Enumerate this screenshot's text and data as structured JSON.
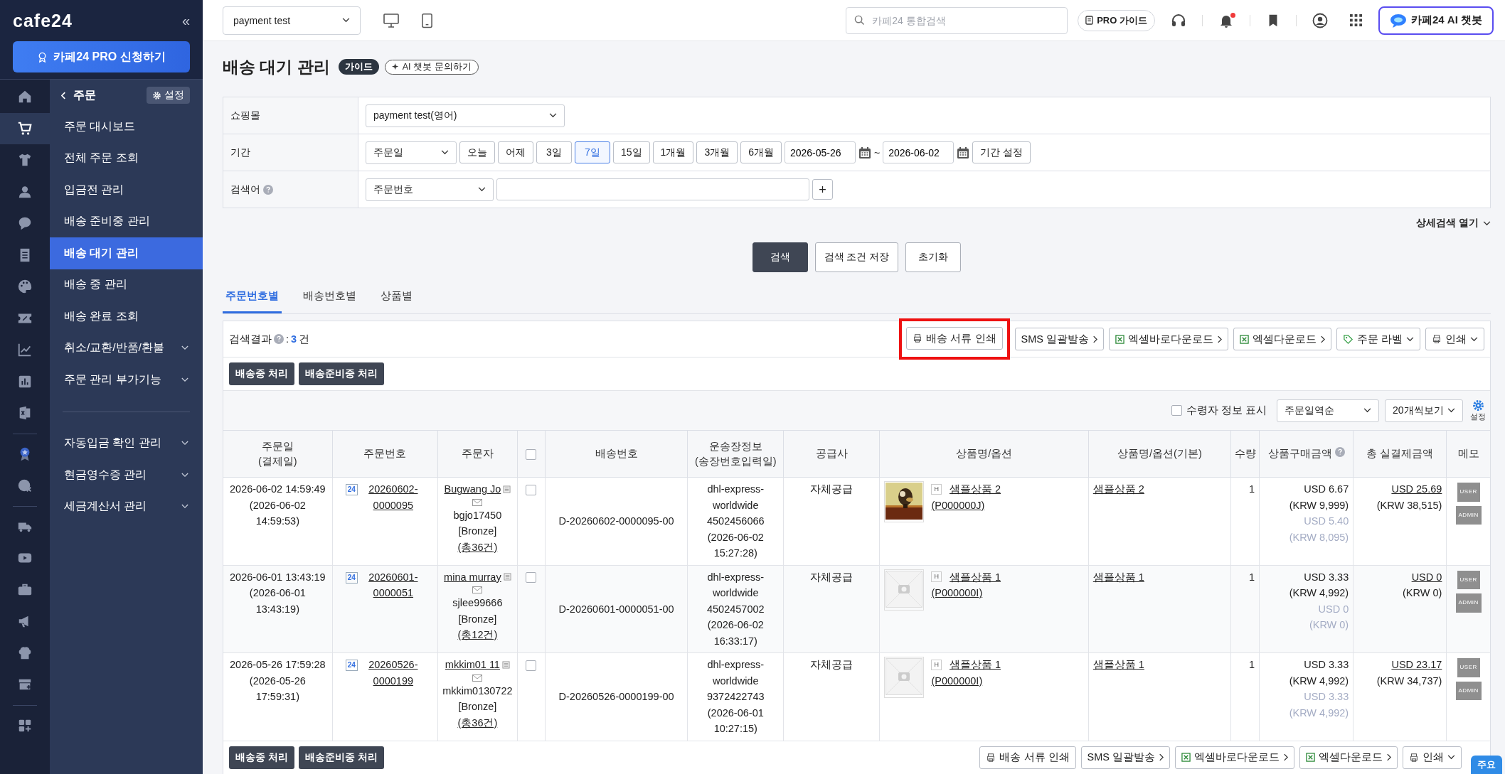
{
  "sidebar": {
    "logo": "cafe24",
    "collapse": "«",
    "pro_button": "카페24 PRO 신청하기",
    "rail": [
      {
        "kind": "nav",
        "selected": false
      },
      {
        "kind": "nav",
        "selected": true
      },
      {
        "kind": "nav",
        "selected": false
      },
      {
        "kind": "nav",
        "selected": false
      },
      {
        "kind": "nav",
        "selected": false
      },
      {
        "kind": "nav",
        "selected": false
      },
      {
        "kind": "nav",
        "selected": false
      },
      {
        "kind": "nav",
        "selected": false
      },
      {
        "kind": "nav",
        "selected": false
      },
      {
        "kind": "nav",
        "selected": false
      },
      {
        "kind": "nav",
        "selected": false
      },
      {
        "kind": "separator"
      },
      {
        "kind": "nav",
        "selected": false
      },
      {
        "kind": "nav",
        "selected": false
      },
      {
        "kind": "separator"
      },
      {
        "kind": "nav",
        "selected": false
      },
      {
        "kind": "nav",
        "selected": false
      },
      {
        "kind": "nav",
        "selected": false
      },
      {
        "kind": "nav",
        "selected": false
      },
      {
        "kind": "nav",
        "selected": false
      },
      {
        "kind": "nav",
        "selected": false
      },
      {
        "kind": "separator"
      },
      {
        "kind": "nav",
        "selected": false
      }
    ],
    "section": "주문",
    "settings_button": "설정",
    "menu_groups": [
      {
        "items": [
          {
            "label": "주문 대시보드",
            "selected": false,
            "expandable": false
          },
          {
            "label": "전체 주문 조회",
            "selected": false,
            "expandable": false
          },
          {
            "label": "입금전 관리",
            "selected": false,
            "expandable": false
          },
          {
            "label": "배송 준비중 관리",
            "selected": false,
            "expandable": false
          },
          {
            "label": "배송 대기 관리",
            "selected": true,
            "expandable": false
          },
          {
            "label": "배송 중 관리",
            "selected": false,
            "expandable": false
          },
          {
            "label": "배송 완료 조회",
            "selected": false,
            "expandable": false
          },
          {
            "label": "취소/교환/반품/환불",
            "selected": false,
            "expandable": true
          },
          {
            "label": "주문 관리 부가기능",
            "selected": false,
            "expandable": true
          }
        ]
      },
      {
        "items": [
          {
            "label": "자동입금 확인 관리",
            "selected": false,
            "expandable": true
          },
          {
            "label": "현금영수증 관리",
            "selected": false,
            "expandable": true
          },
          {
            "label": "세금계산서 관리",
            "selected": false,
            "expandable": true
          }
        ]
      }
    ]
  },
  "topbar": {
    "shop_select": "payment test",
    "search_placeholder": "카페24 통합검색",
    "pro_guide": "PRO 가이드",
    "has_new_notification": true,
    "ai_button": "카페24 AI 챗봇"
  },
  "page": {
    "title": "배송 대기 관리",
    "guide_badge": "가이드",
    "ai_chip": "AI 챗봇 문의하기"
  },
  "filters": {
    "shop_label": "쇼핑몰",
    "shop_value": "payment test(영어)",
    "period_label": "기간",
    "date_type": "주문일",
    "periods": [
      {
        "label": "오늘",
        "selected": false
      },
      {
        "label": "어제",
        "selected": false
      },
      {
        "label": "3일",
        "selected": false
      },
      {
        "label": "7일",
        "selected": true
      },
      {
        "label": "15일",
        "selected": false
      },
      {
        "label": "1개월",
        "selected": false
      },
      {
        "label": "3개월",
        "selected": false
      },
      {
        "label": "6개월",
        "selected": false
      }
    ],
    "start_date": "2026-05-26",
    "range_sep": "~",
    "end_date": "2026-06-02",
    "period_settings": "기간 설정",
    "keyword_label": "검색어",
    "keyword_type": "주문번호",
    "add_button": "+",
    "detail_toggle": "상세검색 열기"
  },
  "search_actions": [
    "검색",
    "검색 조건 저장",
    "초기화"
  ],
  "tabs": [
    {
      "label": "주문번호별",
      "selected": true
    },
    {
      "label": "배송번호별",
      "selected": false
    },
    {
      "label": "상품별",
      "selected": false
    }
  ],
  "results": {
    "label": "검색결과",
    "separator": ":",
    "count": "3",
    "unit": "건",
    "toolbar": [
      {
        "label": "배송 서류 인쇄",
        "kind": "print",
        "highlighted": true
      },
      {
        "label": "SMS 일괄발송",
        "kind": "link",
        "highlighted": false
      },
      {
        "label": "엑셀바로다운로드",
        "kind": "excel",
        "highlighted": false
      },
      {
        "label": "엑셀다운로드",
        "kind": "excel",
        "highlighted": false
      },
      {
        "label": "주문 라벨",
        "kind": "tag-menu",
        "highlighted": false
      },
      {
        "label": "인쇄",
        "kind": "print-menu",
        "highlighted": false
      }
    ],
    "bulk_buttons": [
      "배송중 처리",
      "배송준비중 처리"
    ],
    "show_receiver": {
      "label": "수령자 정보 표시",
      "checked": false
    },
    "sort": "주문일역순",
    "page_size": "20개씩보기",
    "settings": "설정"
  },
  "table": {
    "columns": [
      {
        "kind": "text",
        "label": "주문일",
        "sublabel": "(결제일)"
      },
      {
        "kind": "text",
        "label": "주문번호"
      },
      {
        "kind": "text",
        "label": "주문자"
      },
      {
        "kind": "checkbox",
        "checked": false
      },
      {
        "kind": "text",
        "label": "배송번호"
      },
      {
        "kind": "text",
        "label": "운송장정보",
        "sublabel": "(송장번호입력일)"
      },
      {
        "kind": "text",
        "label": "공급사"
      },
      {
        "kind": "text",
        "label": "상품명/옵션"
      },
      {
        "kind": "text",
        "label": "상품명/옵션(기본)"
      },
      {
        "kind": "text",
        "label": "수량"
      },
      {
        "kind": "help",
        "label": "상품구매금액"
      },
      {
        "kind": "text",
        "label": "총 실결제금액"
      },
      {
        "kind": "text",
        "label": "메모"
      }
    ],
    "rows": [
      {
        "order_date": "2026-06-02 14:59:49",
        "paid_date": "(2026-06-02 14:59:53)",
        "order_badge": "24",
        "order_no": "20260602-0000095",
        "customer": "Bugwang Jo",
        "member_id": "bgjo17450",
        "grade": "[Bronze]",
        "total_orders": "(총36건)",
        "checked": false,
        "shipping_no": "D-20260602-0000095-00",
        "carrier": "dhl-express-worldwide",
        "tracking": "4502456066",
        "tracking_date": "(2026-06-02 15:27:28)",
        "supplier": "자체공급",
        "thumbnail": {
          "kind": "picture"
        },
        "product_badge": "H",
        "product": "샘플상품 2",
        "product_code": "(P000000J)",
        "base_product": "샘플상품 2",
        "qty": "1",
        "price": "USD 6.67",
        "price_krw": "(KRW 9,999)",
        "discount": "USD 5.40",
        "discount_krw": "(KRW 8,095)",
        "total": "USD 25.69",
        "total_krw": "(KRW 38,515)",
        "memo": [
          "USER",
          "ADMIN"
        ]
      },
      {
        "order_date": "2026-06-01 13:43:19",
        "paid_date": "(2026-06-01 13:43:19)",
        "order_badge": "24",
        "order_no": "20260601-0000051",
        "customer": "mina murray",
        "member_id": "sjlee99666",
        "grade": "[Bronze]",
        "total_orders": "(총12건)",
        "checked": false,
        "shipping_no": "D-20260601-0000051-00",
        "carrier": "dhl-express-worldwide",
        "tracking": "4502457002",
        "tracking_date": "(2026-06-02 16:33:17)",
        "supplier": "자체공급",
        "thumbnail": {
          "kind": "placeholder"
        },
        "product_badge": "H",
        "product": "샘플상품 1",
        "product_code": "(P000000I)",
        "base_product": "샘플상품 1",
        "qty": "1",
        "price": "USD 3.33",
        "price_krw": "(KRW 4,992)",
        "discount": "USD 0",
        "discount_krw": "(KRW 0)",
        "total": "USD 0",
        "total_krw": "(KRW 0)",
        "memo": [
          "USER",
          "ADMIN"
        ]
      },
      {
        "order_date": "2026-05-26 17:59:28",
        "paid_date": "(2026-05-26 17:59:31)",
        "order_badge": "24",
        "order_no": "20260526-0000199",
        "customer": "mkkim01 11",
        "member_id": "mkkim0130722",
        "grade": "[Bronze]",
        "total_orders": "(총36건)",
        "checked": false,
        "shipping_no": "D-20260526-0000199-00",
        "carrier": "dhl-express-worldwide",
        "tracking": "9372422743",
        "tracking_date": "(2026-06-01 10:27:15)",
        "supplier": "자체공급",
        "thumbnail": {
          "kind": "placeholder"
        },
        "product_badge": "H",
        "product": "샘플상품 1",
        "product_code": "(P000000I)",
        "base_product": "샘플상품 1",
        "qty": "1",
        "price": "USD 3.33",
        "price_krw": "(KRW 4,992)",
        "discount": "USD 3.33",
        "discount_krw": "(KRW 4,992)",
        "total": "USD 23.17",
        "total_krw": "(KRW 34,737)",
        "memo": [
          "USER",
          "ADMIN"
        ]
      }
    ]
  },
  "footer": {
    "bulk_buttons": [
      "배송중 처리",
      "배송준비중 처리"
    ],
    "toolbar": [
      {
        "label": "배송 서류 인쇄",
        "kind": "print",
        "highlighted": false
      },
      {
        "label": "SMS 일괄발송",
        "kind": "link",
        "highlighted": false
      },
      {
        "label": "엑셀바로다운로드",
        "kind": "excel",
        "highlighted": false
      },
      {
        "label": "엑셀다운로드",
        "kind": "excel",
        "highlighted": false
      },
      {
        "label": "인쇄",
        "kind": "print-menu",
        "highlighted": false
      }
    ]
  },
  "floating_menu": "주요"
}
